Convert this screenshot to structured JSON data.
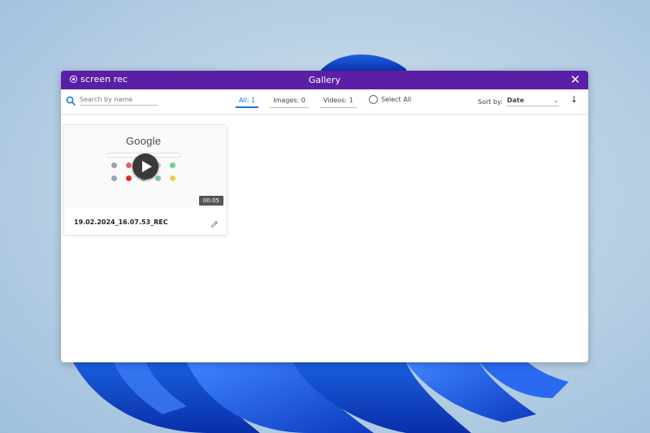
{
  "window": {
    "brand": "screen rec",
    "title": "Gallery",
    "close_glyph": "✕",
    "accent": "#5b1fa6"
  },
  "toolbar": {
    "search_placeholder": "Search by name",
    "tabs": [
      {
        "label": "All: 1",
        "active": true
      },
      {
        "label": "Images: 0",
        "active": false
      },
      {
        "label": "Videos: 1",
        "active": false
      }
    ],
    "select_all_label": "Select All",
    "sort_label": "Sort by:",
    "sort_value": "Date",
    "sort_direction_glyph": "↓"
  },
  "items": [
    {
      "name": "19.02.2024_16.07.53_REC",
      "duration": "00:05",
      "thumbnail_logo": "Google",
      "type": "video"
    }
  ],
  "icons": {
    "search": "search-icon",
    "play": "play-icon",
    "edit": "pencil-icon",
    "close": "close-icon",
    "sort_direction": "arrow-down-icon",
    "select_all": "radio-circle-icon"
  }
}
